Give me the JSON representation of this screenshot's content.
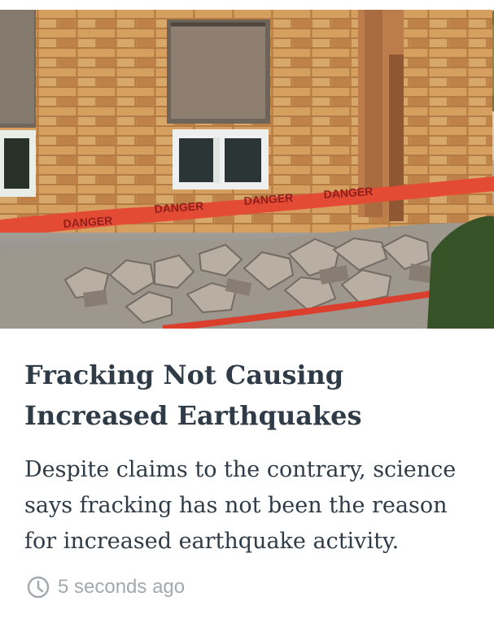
{
  "article": {
    "image_alt": "Damaged brick building with rubble and red danger tape",
    "danger_tape_text": "DANGER",
    "title": "Fracking Not Causing Increased Earthquakes",
    "summary": "Despite claims to the contrary, science says fracking has not been the reason for increased earthquake activity.",
    "timestamp": "5 seconds ago",
    "timestamp_icon": "clock-icon"
  },
  "colors": {
    "text": "#2f3b46",
    "meta": "#a3a9ae",
    "tape": "#e44b35",
    "brick": "#c98f4f"
  }
}
